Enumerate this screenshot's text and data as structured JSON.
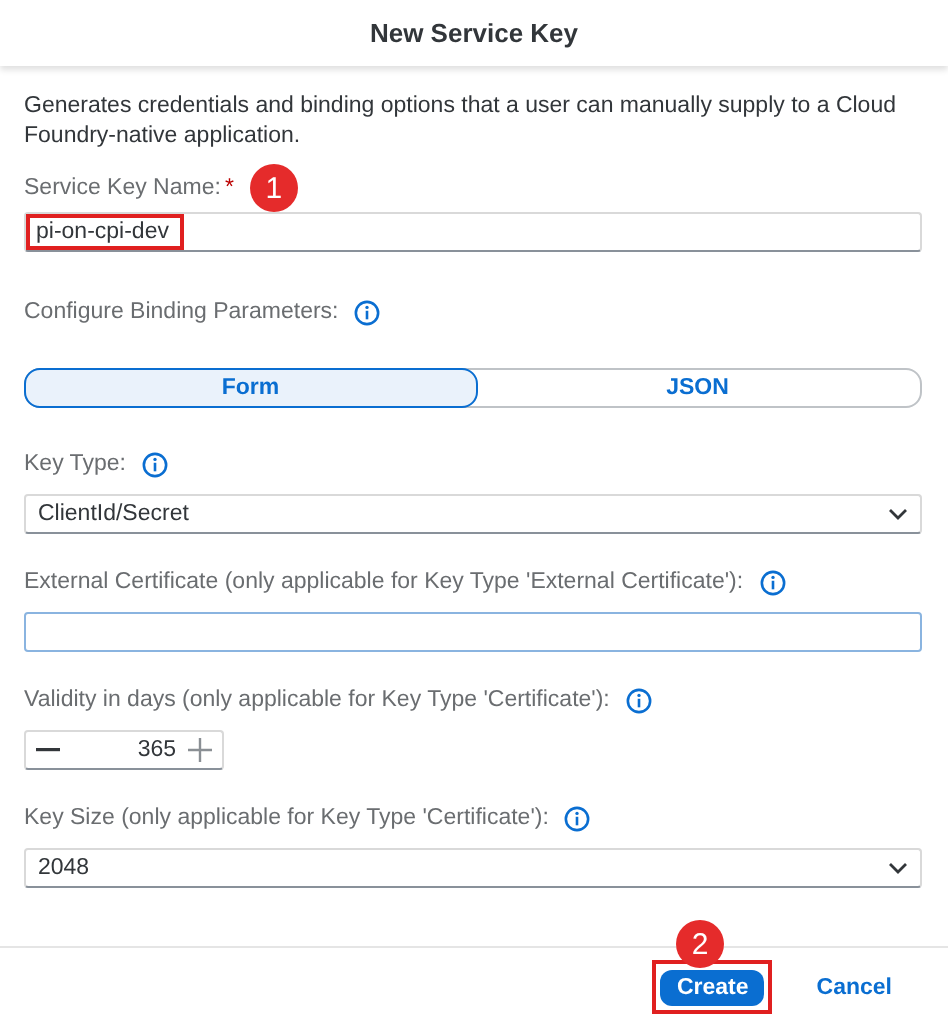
{
  "dialog": {
    "title": "New Service Key"
  },
  "description": "Generates credentials and binding options that a user can manually supply to a Cloud Foundry-native application.",
  "name_field": {
    "label": "Service Key Name:",
    "required_mark": "*",
    "value": "pi-on-cpi-dev",
    "highlighted": true,
    "step_badge": "1"
  },
  "binding": {
    "label": "Configure Binding Parameters:"
  },
  "modes": [
    {
      "label": "Form",
      "selected": true
    },
    {
      "label": "JSON",
      "selected": false
    }
  ],
  "fields": [
    {
      "kind": "select",
      "label": "Key Type:",
      "value": "ClientId/Secret"
    },
    {
      "kind": "input",
      "label": "External Certificate (only applicable for Key Type 'External Certificate'):"
    },
    {
      "kind": "stepper",
      "label": "Validity in days (only applicable for Key Type 'Certificate'):",
      "value": "365"
    },
    {
      "kind": "select",
      "label": "Key Size (only applicable for Key Type 'Certificate'):",
      "value": "2048"
    }
  ],
  "footer": {
    "step_badge": "2",
    "buttons": [
      {
        "label": "Create",
        "kind": "primary",
        "highlighted": true
      },
      {
        "label": "Cancel",
        "kind": "transparent",
        "highlighted": false
      }
    ]
  }
}
